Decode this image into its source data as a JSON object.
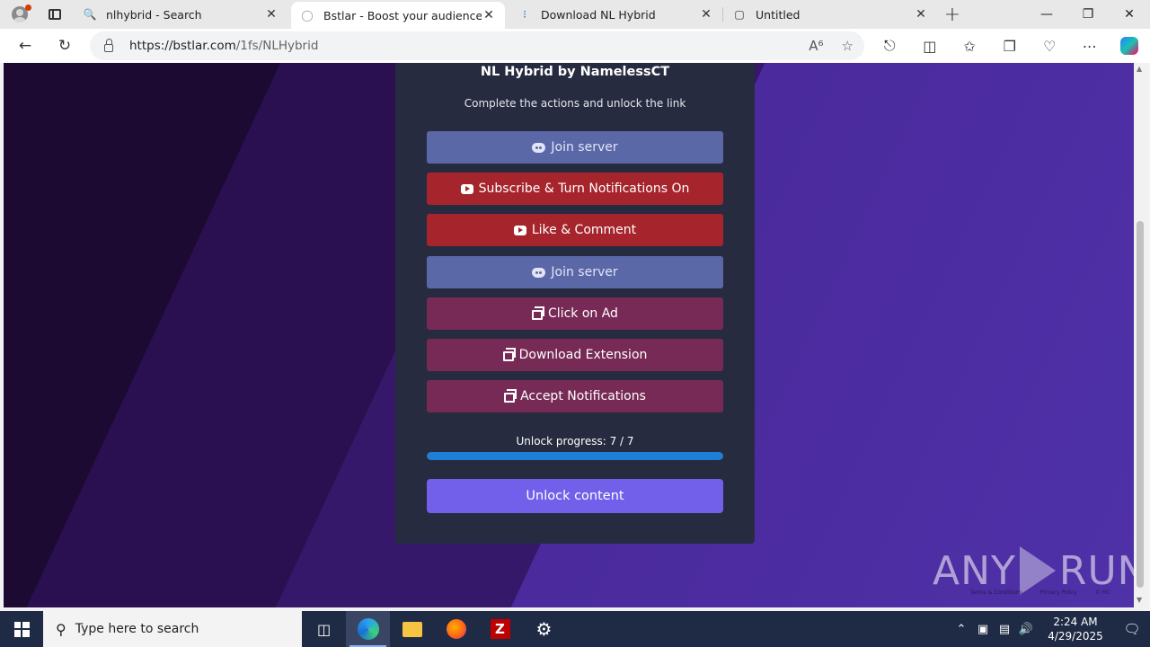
{
  "browser": {
    "tabs": [
      {
        "title": "nlhybrid - Search",
        "icon": "search-icon"
      },
      {
        "title": "Bstlar - Boost your audience",
        "icon": "chat-icon",
        "active": true
      },
      {
        "title": "Download NL Hybrid",
        "icon": "loading-icon"
      },
      {
        "title": "Untitled",
        "icon": "page-icon"
      }
    ],
    "url_host": "https://bstlar.com",
    "url_path": "/1fs/NLHybrid"
  },
  "page": {
    "title": "NL Hybrid by NamelessCT",
    "subtitle": "Complete the actions and unlock the link",
    "actions": [
      {
        "label": "Join server",
        "kind": "discord"
      },
      {
        "label": "Subscribe & Turn Notifications On",
        "kind": "youtube"
      },
      {
        "label": "Like & Comment",
        "kind": "youtube"
      },
      {
        "label": "Join server",
        "kind": "discord"
      },
      {
        "label": "Click on Ad",
        "kind": "ad"
      },
      {
        "label": "Download Extension",
        "kind": "ad"
      },
      {
        "label": "Accept Notifications",
        "kind": "ad"
      }
    ],
    "progress_label": "Unlock progress: 7 / 7",
    "progress_fraction": 1.0,
    "unlock_label": "Unlock content",
    "footer": [
      "Terms & Conditions",
      "Privacy Policy",
      "© HC"
    ]
  },
  "watermark": {
    "left": "ANY",
    "right": "RUN"
  },
  "taskbar": {
    "search_placeholder": "Type here to search",
    "time": "2:24 AM",
    "date": "4/29/2025"
  },
  "colors": {
    "discord": "#5b68a8",
    "youtube": "#a6242b",
    "ad": "#772a55",
    "unlock": "#7360ea",
    "progress": "#1d7fd6"
  }
}
